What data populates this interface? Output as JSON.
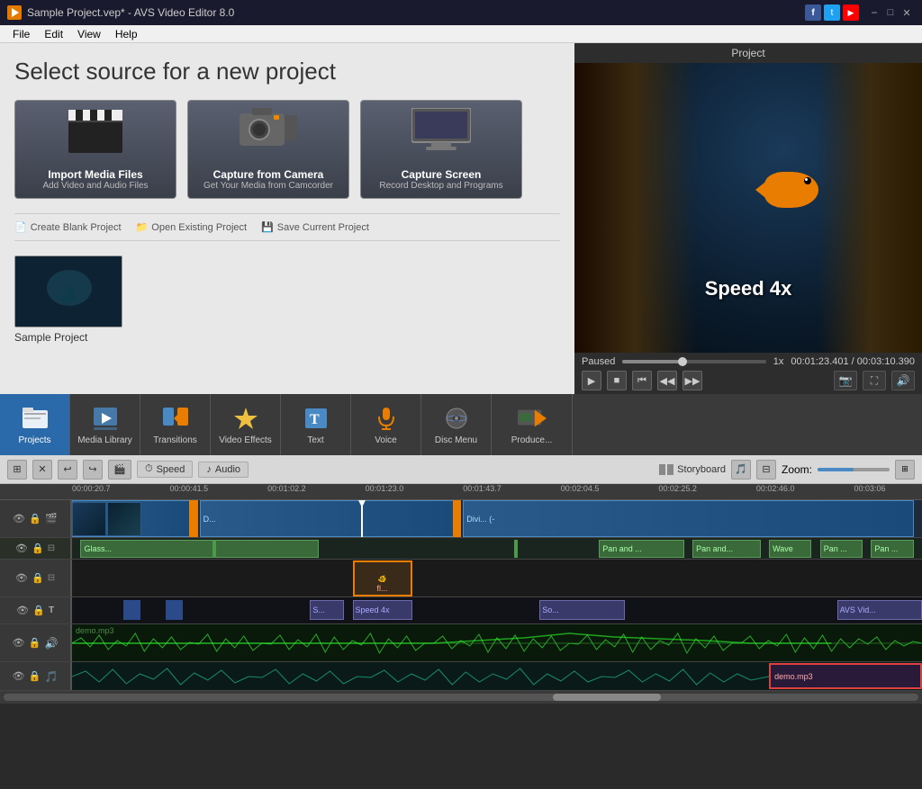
{
  "titlebar": {
    "title": "Sample Project.vep* - AVS Video Editor 8.0",
    "icon": "▶",
    "minimize_label": "−",
    "maximize_label": "□",
    "close_label": "✕",
    "fb_label": "f",
    "tw_label": "t",
    "yt_label": "▶"
  },
  "menubar": {
    "items": [
      "File",
      "Edit",
      "View",
      "Help"
    ]
  },
  "main": {
    "heading": "Select source for a new project",
    "sources": [
      {
        "label": "Import Media Files",
        "sublabel": "Add Video and Audio Files",
        "type": "import"
      },
      {
        "label": "Capture from Camera",
        "sublabel": "Get Your Media from Camcorder",
        "type": "camera"
      },
      {
        "label": "Capture Screen",
        "sublabel": "Record Desktop and Programs",
        "type": "screen"
      }
    ],
    "quick_links": [
      {
        "label": "Create Blank Project",
        "icon": "📄"
      },
      {
        "label": "Open Existing Project",
        "icon": "📁"
      },
      {
        "label": "Save Current Project",
        "icon": "💾"
      }
    ],
    "recent_project_label": "Sample Project"
  },
  "preview": {
    "title": "Project",
    "speed_text": "Speed 4x",
    "status": "Paused",
    "speed_label": "1x",
    "time_current": "00:01:23.401",
    "time_total": "00:03:10.390",
    "controls": [
      "▶",
      "■",
      "⏮",
      "◀◀",
      "▶▶"
    ]
  },
  "toolbar": {
    "items": [
      {
        "label": "Projects",
        "icon": "🎬",
        "active": true
      },
      {
        "label": "Media Library",
        "icon": "🎞"
      },
      {
        "label": "Transitions",
        "icon": "🔶"
      },
      {
        "label": "Video Effects",
        "icon": "⭐"
      },
      {
        "label": "Text",
        "icon": "T"
      },
      {
        "label": "Voice",
        "icon": "🎤"
      },
      {
        "label": "Disc Menu",
        "icon": "💿"
      },
      {
        "label": "Produce...",
        "icon": "▶▶"
      }
    ]
  },
  "timeline_controls": {
    "speed_label": "Speed",
    "audio_label": "Audio",
    "storyboard_label": "Storyboard",
    "zoom_label": "Zoom:"
  },
  "timeline": {
    "ruler_marks": [
      "00:00:20.7",
      "00:00:41.5",
      "00:01:02.2",
      "00:01:23.0",
      "00:01:43.7",
      "00:02:04.5",
      "00:02:25.2",
      "00:02:46.0",
      "00:03:06"
    ],
    "tracks": [
      {
        "type": "video",
        "clips": [
          "D...",
          "D...",
          "(−"
        ]
      },
      {
        "type": "effects",
        "clips": [
          "Glass...",
          "Pan and ...",
          "Pan and...",
          "Wave",
          "Pan ...",
          "Pan ..."
        ]
      },
      {
        "type": "overlay",
        "clips": [
          "fl..."
        ]
      },
      {
        "type": "text",
        "clips": [
          "S...",
          "Speed 4x",
          "So...",
          "AVS Vid..."
        ]
      },
      {
        "type": "audio",
        "clips": [
          "demo.mp3"
        ]
      },
      {
        "type": "audio2",
        "clips": [
          "demo.mp3"
        ]
      }
    ]
  }
}
